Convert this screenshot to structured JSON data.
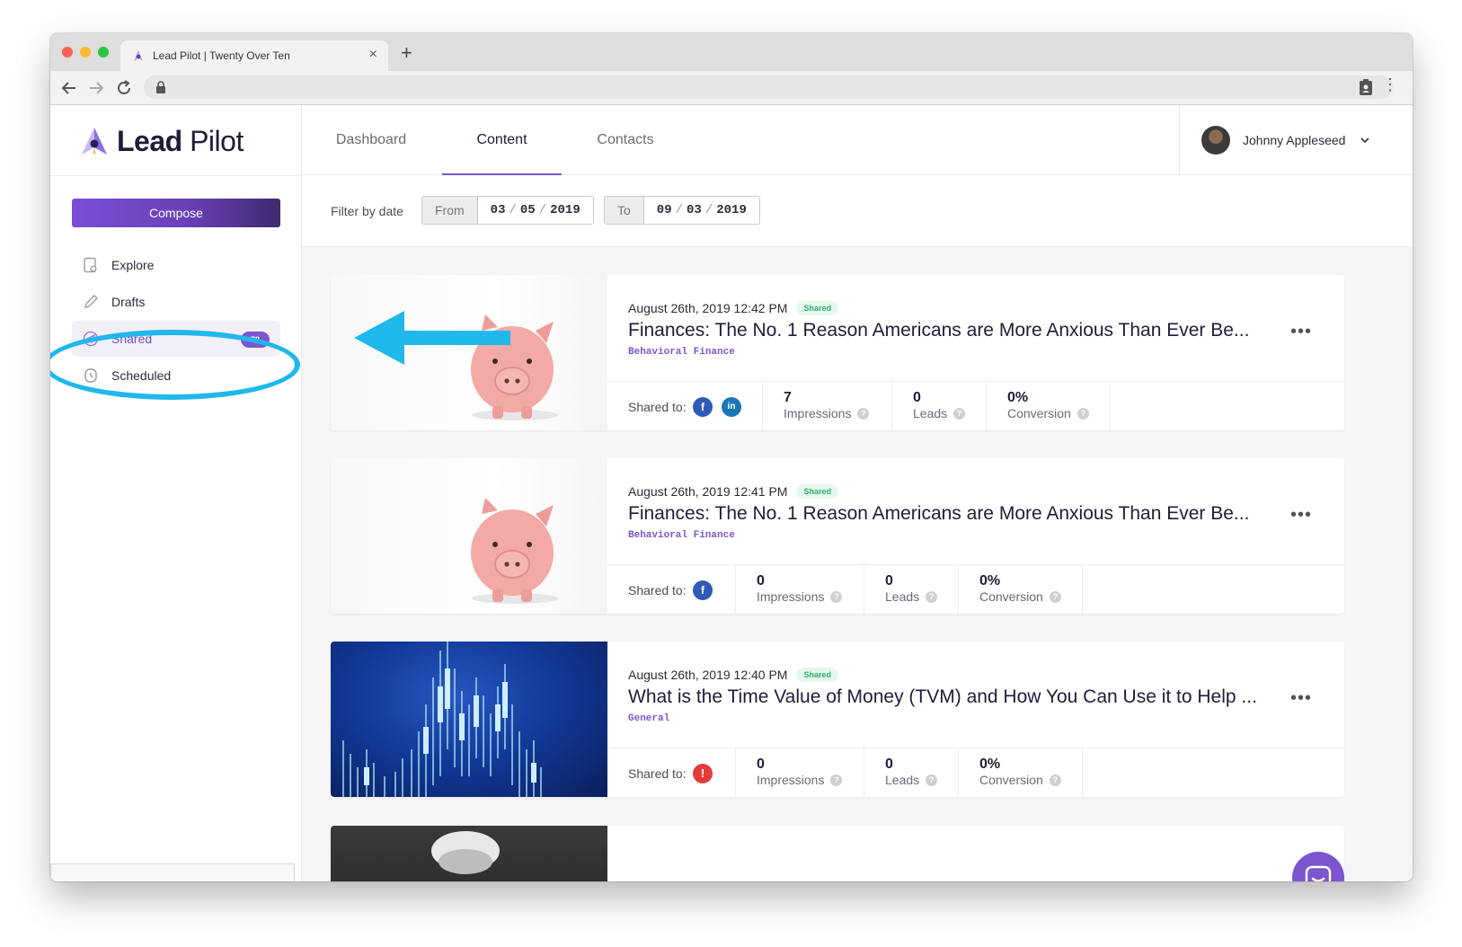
{
  "browser": {
    "tab_title": "Lead Pilot | Twenty Over Ten",
    "new_tab": "+",
    "tab_close": "×"
  },
  "brand": {
    "name_bold": "Lead",
    "name_light": "Pilot",
    "accent": "#7b56cf"
  },
  "sidebar": {
    "compose_label": "Compose",
    "items": [
      {
        "label": "Explore",
        "icon": "explore-icon"
      },
      {
        "label": "Drafts",
        "icon": "pencil-icon"
      },
      {
        "label": "Shared",
        "icon": "send-icon",
        "badge": "78"
      },
      {
        "label": "Scheduled",
        "icon": "clock-icon"
      }
    ]
  },
  "topnav": {
    "tabs": [
      {
        "label": "Dashboard"
      },
      {
        "label": "Content"
      },
      {
        "label": "Contacts"
      }
    ],
    "user_name": "Johnny Appleseed"
  },
  "filter": {
    "label": "Filter by date",
    "from_label": "From",
    "from": {
      "mm": "03",
      "dd": "05",
      "yyyy": "2019"
    },
    "to_label": "To",
    "to": {
      "mm": "09",
      "dd": "03",
      "yyyy": "2019"
    },
    "sep": "/"
  },
  "posts": [
    {
      "date": "August 26th, 2019 12:42 PM",
      "status": "Shared",
      "title": "Finances: The No. 1 Reason Americans are More Anxious Than Ever Be...",
      "category": "Behavioral Finance",
      "shared_to_label": "Shared to:",
      "networks": [
        "f",
        "in"
      ],
      "impressions": "7",
      "leads": "0",
      "conversion": "0%"
    },
    {
      "date": "August 26th, 2019 12:41 PM",
      "status": "Shared",
      "title": "Finances: The No. 1 Reason Americans are More Anxious Than Ever Be...",
      "category": "Behavioral Finance",
      "shared_to_label": "Shared to:",
      "networks": [
        "f"
      ],
      "impressions": "0",
      "leads": "0",
      "conversion": "0%"
    },
    {
      "date": "August 26th, 2019 12:40 PM",
      "status": "Shared",
      "title": "What is the Time Value of Money (TVM) and How You Can Use it to Help ...",
      "category": "General",
      "shared_to_label": "Shared to:",
      "networks": [
        "!"
      ],
      "impressions": "0",
      "leads": "0",
      "conversion": "0%"
    }
  ],
  "stat_labels": {
    "impressions": "Impressions",
    "leads": "Leads",
    "conversion": "Conversion",
    "help": "?"
  },
  "more_label": "•••",
  "annotation_color": "#1fb8ec"
}
